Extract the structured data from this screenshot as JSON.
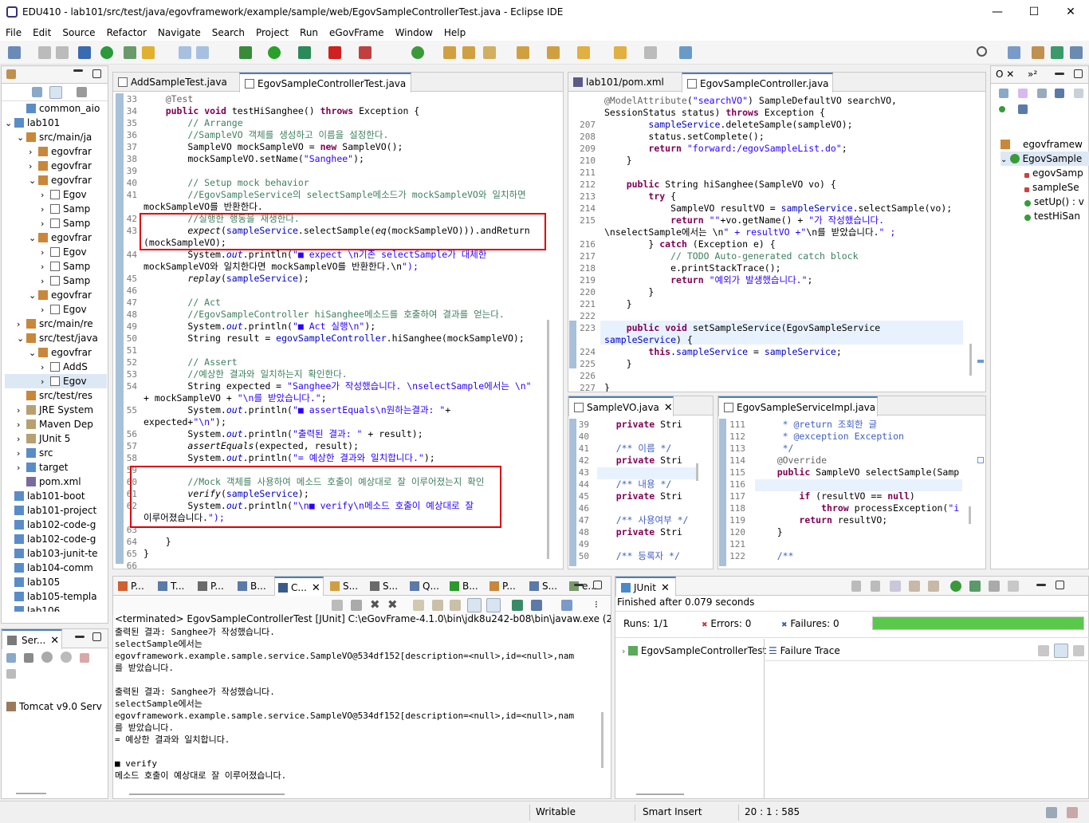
{
  "window": {
    "title": "EDU410 - lab101/src/test/java/egovframework/example/sample/web/EgovSampleControllerTest.java - Eclipse IDE",
    "minimize": "—",
    "maximize": "☐",
    "close": "✕"
  },
  "menu": [
    "File",
    "Edit",
    "Source",
    "Refactor",
    "Navigate",
    "Search",
    "Project",
    "Run",
    "eGovFrame",
    "Window",
    "Help"
  ],
  "explorer": {
    "items": [
      {
        "indent": 1,
        "arrow": "",
        "icon": "folder",
        "label": "common_aio"
      },
      {
        "indent": 0,
        "arrow": "⌄",
        "icon": "folder",
        "label": "lab101"
      },
      {
        "indent": 1,
        "arrow": "⌄",
        "icon": "pkg",
        "label": "src/main/ja"
      },
      {
        "indent": 2,
        "arrow": "›",
        "icon": "pkg",
        "label": "egovfrar"
      },
      {
        "indent": 2,
        "arrow": "›",
        "icon": "pkg",
        "label": "egovfrar"
      },
      {
        "indent": 2,
        "arrow": "⌄",
        "icon": "pkg",
        "label": "egovfrar"
      },
      {
        "indent": 3,
        "arrow": "›",
        "icon": "java",
        "label": "Egov"
      },
      {
        "indent": 3,
        "arrow": "›",
        "icon": "java",
        "label": "Samp"
      },
      {
        "indent": 3,
        "arrow": "›",
        "icon": "java",
        "label": "Samp"
      },
      {
        "indent": 2,
        "arrow": "⌄",
        "icon": "pkg",
        "label": "egovfrar"
      },
      {
        "indent": 3,
        "arrow": "›",
        "icon": "java",
        "label": "Egov"
      },
      {
        "indent": 3,
        "arrow": "›",
        "icon": "java",
        "label": "Samp"
      },
      {
        "indent": 3,
        "arrow": "›",
        "icon": "java",
        "label": "Samp"
      },
      {
        "indent": 2,
        "arrow": "⌄",
        "icon": "pkg",
        "label": "egovfrar"
      },
      {
        "indent": 3,
        "arrow": "›",
        "icon": "java",
        "label": "Egov"
      },
      {
        "indent": 1,
        "arrow": "›",
        "icon": "pkg",
        "label": "src/main/re"
      },
      {
        "indent": 1,
        "arrow": "⌄",
        "icon": "pkg",
        "label": "src/test/java"
      },
      {
        "indent": 2,
        "arrow": "⌄",
        "icon": "pkg",
        "label": "egovfrar"
      },
      {
        "indent": 3,
        "arrow": "›",
        "icon": "java",
        "label": "AddS"
      },
      {
        "indent": 3,
        "arrow": "›",
        "icon": "java",
        "label": "Egov"
      },
      {
        "indent": 1,
        "arrow": "",
        "icon": "pkg",
        "label": "src/test/res"
      },
      {
        "indent": 1,
        "arrow": "›",
        "icon": "lib",
        "label": "JRE System"
      },
      {
        "indent": 1,
        "arrow": "›",
        "icon": "lib",
        "label": "Maven Dep"
      },
      {
        "indent": 1,
        "arrow": "›",
        "icon": "lib",
        "label": "JUnit 5"
      },
      {
        "indent": 1,
        "arrow": "›",
        "icon": "folder",
        "label": "src"
      },
      {
        "indent": 1,
        "arrow": "›",
        "icon": "folder",
        "label": "target"
      },
      {
        "indent": 1,
        "arrow": "",
        "icon": "xml",
        "label": "pom.xml"
      },
      {
        "indent": 0,
        "arrow": "",
        "icon": "folder",
        "label": "lab101-boot"
      },
      {
        "indent": 0,
        "arrow": "",
        "icon": "folder",
        "label": "lab101-project"
      },
      {
        "indent": 0,
        "arrow": "",
        "icon": "folder",
        "label": "lab102-code-g"
      },
      {
        "indent": 0,
        "arrow": "",
        "icon": "folder",
        "label": "lab102-code-g"
      },
      {
        "indent": 0,
        "arrow": "",
        "icon": "folder",
        "label": "lab103-junit-te"
      },
      {
        "indent": 0,
        "arrow": "",
        "icon": "folder",
        "label": "lab104-comm"
      },
      {
        "indent": 0,
        "arrow": "",
        "icon": "folder",
        "label": "lab105"
      },
      {
        "indent": 0,
        "arrow": "",
        "icon": "folder",
        "label": "lab105-templa"
      },
      {
        "indent": 0,
        "arrow": "",
        "icon": "folder",
        "label": "lab106"
      }
    ]
  },
  "servers": {
    "tab": "Ser...",
    "item": "Tomcat v9.0 Serv"
  },
  "editor_left": {
    "tabs": [
      "AddSampleTest.java",
      "EgovSampleControllerTest.java"
    ],
    "lines": [
      [
        "33",
        "    @Test"
      ],
      [
        "34",
        "    public void testHiSanghee() throws Exception {"
      ],
      [
        "35",
        "        // Arrange"
      ],
      [
        "36",
        "        //SampleVO 객체를 생성하고 이름을 설정한다."
      ],
      [
        "37",
        "        SampleVO mockSampleVO = new SampleVO();"
      ],
      [
        "38",
        "        mockSampleVO.setName(\"Sanghee\");"
      ],
      [
        "39",
        ""
      ],
      [
        "40",
        "        // Setup mock behavior"
      ],
      [
        "41",
        "        //EgovSampleService의 selectSample메소드가 mockSampleVO와 일치하면"
      ],
      [
        "",
        "mockSampleVO를 반환한다."
      ],
      [
        "42",
        "        //실행한 행동을 재생한다."
      ],
      [
        "43",
        "        expect(sampleService.selectSample(eq(mockSampleVO))).andReturn"
      ],
      [
        "",
        "(mockSampleVO);"
      ],
      [
        "44",
        "        System.out.println(\"■ expect \\n기존 selectSample가 대체한"
      ],
      [
        "",
        "mockSampleVO와 일치한다면 mockSampleVO를 반환한다.\\n\");"
      ],
      [
        "45",
        "        replay(sampleService);"
      ],
      [
        "46",
        ""
      ],
      [
        "47",
        "        // Act"
      ],
      [
        "48",
        "        //EgovSampleController hiSanghee메소드를 호출하여 결과를 얻는다."
      ],
      [
        "49",
        "        System.out.println(\"■ Act 실행\\n\");"
      ],
      [
        "50",
        "        String result = egovSampleController.hiSanghee(mockSampleVO);"
      ],
      [
        "51",
        ""
      ],
      [
        "52",
        "        // Assert"
      ],
      [
        "53",
        "        //예상한 결과와 일치하는지 확인한다."
      ],
      [
        "54",
        "        String expected = \"Sanghee가 작성했습니다. \\nselectSample에서는 \\n\""
      ],
      [
        "",
        "+ mockSampleVO + \"\\n를 받았습니다.\";"
      ],
      [
        "55",
        "        System.out.println(\"■ assertEquals\\n원하는결과: \"+"
      ],
      [
        "",
        "expected+\"\\n\");"
      ],
      [
        "56",
        "        System.out.println(\"출력된 결과: \" + result);"
      ],
      [
        "57",
        "        assertEquals(expected, result);"
      ],
      [
        "58",
        "        System.out.println(\"= 예상한 결과와 일치합니다.\");"
      ],
      [
        "59",
        ""
      ],
      [
        "60",
        "        //Mock 객체를 사용하여 메소드 호출이 예상대로 잘 이루어졌는지 확인"
      ],
      [
        "61",
        "        verify(sampleService);"
      ],
      [
        "62",
        "        System.out.println(\"\\n■ verify\\n메소드 호출이 예상대로 잘"
      ],
      [
        "",
        "이루어졌습니다.\");"
      ],
      [
        "63",
        ""
      ],
      [
        "64",
        "    }"
      ],
      [
        "65",
        "}"
      ],
      [
        "66",
        ""
      ]
    ]
  },
  "editor_right": {
    "tabs": [
      "lab101/pom.xml",
      "EgovSampleController.java"
    ],
    "lines": [
      [
        "",
        "@ModelAttribute(\"searchVO\") SampleDefaultVO searchVO,"
      ],
      [
        "",
        "SessionStatus status) throws Exception {"
      ],
      [
        "207",
        "        sampleService.deleteSample(sampleVO);"
      ],
      [
        "208",
        "        status.setComplete();"
      ],
      [
        "209",
        "        return \"forward:/egovSampleList.do\";"
      ],
      [
        "210",
        "    }"
      ],
      [
        "211",
        ""
      ],
      [
        "212",
        "    public String hiSanghee(SampleVO vo) {"
      ],
      [
        "213",
        "        try {"
      ],
      [
        "214",
        "            SampleVO resultVO = sampleService.selectSample(vo);"
      ],
      [
        "215",
        "            return \"\"+vo.getName() + \"가 작성했습니다."
      ],
      [
        "",
        "\\nselectSample에서는 \\n\" + resultVO +\"\\n를 받았습니다.\" ;"
      ],
      [
        "216",
        "        } catch (Exception e) {"
      ],
      [
        "217",
        "            // TODO Auto-generated catch block"
      ],
      [
        "218",
        "            e.printStackTrace();"
      ],
      [
        "219",
        "            return \"예외가 발생했습니다.\";"
      ],
      [
        "220",
        "        }"
      ],
      [
        "221",
        "    }"
      ],
      [
        "222",
        ""
      ],
      [
        "223",
        "    public void setSampleService(EgovSampleService"
      ],
      [
        "",
        "sampleService) {"
      ],
      [
        "224",
        "        this.sampleService = sampleService;"
      ],
      [
        "225",
        "    }"
      ],
      [
        "226",
        ""
      ],
      [
        "227",
        "}"
      ]
    ]
  },
  "sample_vo": {
    "tab": "SampleVO.java",
    "lines": [
      [
        "39",
        "    private Stri"
      ],
      [
        "40",
        ""
      ],
      [
        "41",
        "    /** 이름 */"
      ],
      [
        "42",
        "    private Stri"
      ],
      [
        "43",
        ""
      ],
      [
        "44",
        "    /** 내용 */"
      ],
      [
        "45",
        "    private Stri"
      ],
      [
        "46",
        ""
      ],
      [
        "47",
        "    /** 사용여부 */"
      ],
      [
        "48",
        "    private Stri"
      ],
      [
        "49",
        ""
      ],
      [
        "50",
        "    /** 등록자 */"
      ]
    ]
  },
  "impl": {
    "tab": "EgovSampleServiceImpl.java",
    "lines": [
      [
        "111",
        "     * @return 조회한 글"
      ],
      [
        "112",
        "     * @exception Exception"
      ],
      [
        "113",
        "     */"
      ],
      [
        "114",
        "    @Override"
      ],
      [
        "115",
        "    public SampleVO selectSample(Samp"
      ],
      [
        "116",
        "        SampleVO resultVO = sampleDAO"
      ],
      [
        "117",
        "        if (resultVO == null)"
      ],
      [
        "118",
        "            throw processException(\"i"
      ],
      [
        "119",
        "        return resultVO;"
      ],
      [
        "120",
        "    }"
      ],
      [
        "121",
        ""
      ],
      [
        "122",
        "    /**"
      ]
    ]
  },
  "outline": {
    "items": [
      "egovframew",
      "EgovSample",
      "egovSamp",
      "sampleSe",
      "setUp() : v",
      "testHiSan"
    ]
  },
  "console": {
    "tabs": [
      "P...",
      "T...",
      "P...",
      "B...",
      "C...",
      "S...",
      "S...",
      "Q...",
      "B...",
      "P...",
      "S...",
      "e..."
    ],
    "header": "<terminated> EgovSampleControllerTest [JUnit] C:\\eGovFrame-4.1.0\\bin\\jdk8u242-b08\\bin\\javaw.exe  (2023. 1",
    "lines": [
      "출력된 결과: Sanghee가 작성했습니다.",
      "selectSample에서는",
      "egovframework.example.sample.service.SampleVO@534df152[description=<null>,id=<null>,nam",
      "를 받았습니다.",
      "",
      "출력된 결과: Sanghee가 작성했습니다.",
      "selectSample에서는",
      "egovframework.example.sample.service.SampleVO@534df152[description=<null>,id=<null>,nam",
      "를 받았습니다.",
      "= 예상한 결과와 일치합니다.",
      "",
      "■ verify",
      "메소드 호출이 예상대로 잘 이루어졌습니다."
    ]
  },
  "junit": {
    "tab": "JUnit",
    "finished": "Finished after 0.079 seconds",
    "runs_label": "Runs:",
    "runs": "1/1",
    "errors_label": "Errors:",
    "errors": "0",
    "failures_label": "Failures:",
    "failures": "0",
    "progress": 1.0,
    "bar_color": "#5ac84a",
    "test": "EgovSampleControllerTest",
    "trace": "Failure Trace"
  },
  "status": {
    "writable": "Writable",
    "insert": "Smart Insert",
    "pos": "20 : 1 : 585"
  }
}
